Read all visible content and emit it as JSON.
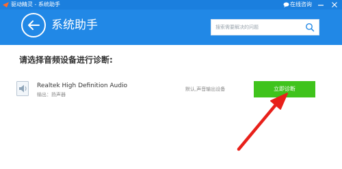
{
  "window": {
    "title": "驱动精灵 - 系统助手",
    "online_label": "在线咨询"
  },
  "header": {
    "page_title": "系统助手",
    "search_placeholder": "搜索需要解决的问题"
  },
  "main": {
    "prompt": "请选择音频设备进行诊断:",
    "device": {
      "name": "Realtek High Definition Audio",
      "output": "输出：扬声器",
      "default_label": "默认,声音输出设备",
      "diagnose_label": "立即诊断"
    }
  },
  "colors": {
    "titlebar": "#1b7fde",
    "header": "#2188e6",
    "button": "#3fc31c",
    "arrow": "#e8201a"
  }
}
